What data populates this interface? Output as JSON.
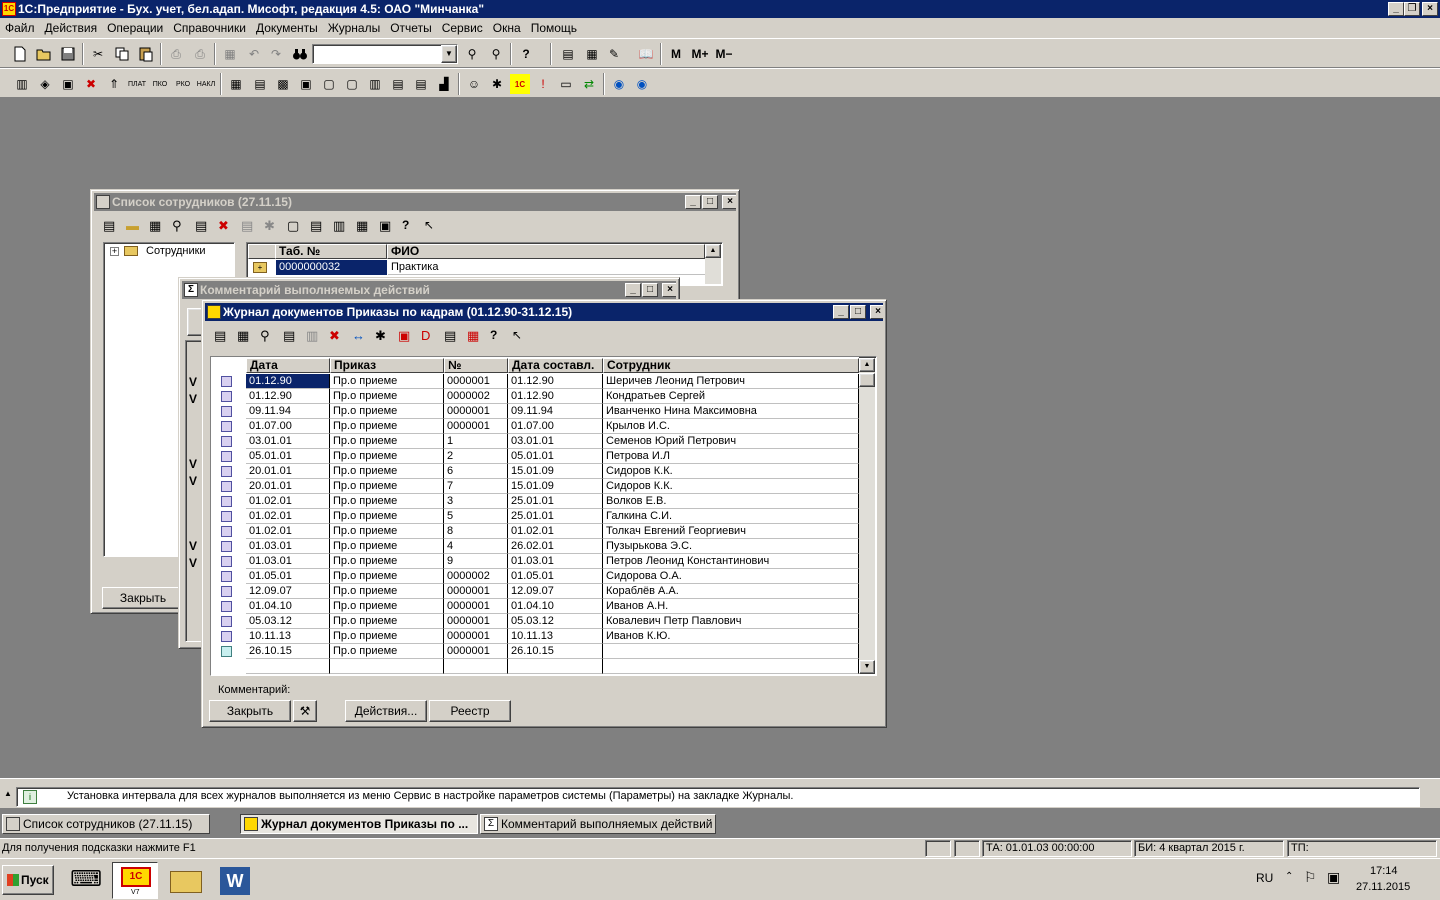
{
  "app": {
    "title": "1С:Предприятие - Бух. учет, бел.адап. Мисофт, редакция 4.5: ОАО \"Минчанка\""
  },
  "menu": [
    "Файл",
    "Действия",
    "Операции",
    "Справочники",
    "Документы",
    "Журналы",
    "Отчеты",
    "Сервис",
    "Окна",
    "Помощь"
  ],
  "toolbar": {
    "m1": "M",
    "m2": "M+",
    "m3": "M−"
  },
  "employees_window": {
    "title": "Список сотрудников (27.11.15)",
    "tree_root": "Сотрудники",
    "columns": [
      "Таб. №",
      "ФИО"
    ],
    "rows": [
      [
        "0000000032",
        "Практика"
      ]
    ],
    "close_button": "Закрыть"
  },
  "comment_window": {
    "title": "Комментарий выполняемых действий",
    "marks": [
      "V",
      "V",
      "V",
      "V",
      "V",
      "V"
    ]
  },
  "journal_window": {
    "title": "Журнал документов  Приказы по кадрам (01.12.90-31.12.15)",
    "columns": [
      "Дата",
      "Приказ",
      "№",
      "Дата составл.",
      "Сотрудник"
    ],
    "rows": [
      [
        "01.12.90",
        "Пр.о приеме",
        "0000001",
        "01.12.90",
        "Шеричев Леонид Петрович"
      ],
      [
        "01.12.90",
        "Пр.о приеме",
        "0000002",
        "01.12.90",
        "Кондратьев Сергей"
      ],
      [
        "09.11.94",
        "Пр.о приеме",
        "0000001",
        "09.11.94",
        "Иванченко Нина Максимовна"
      ],
      [
        "01.07.00",
        "Пр.о приеме",
        "0000001",
        "01.07.00",
        "Крылов И.С."
      ],
      [
        "03.01.01",
        "Пр.о приеме",
        "1",
        "03.01.01",
        "Семенов Юрий Петрович"
      ],
      [
        "05.01.01",
        "Пр.о приеме",
        "2",
        "05.01.01",
        "Петрова И.Л"
      ],
      [
        "20.01.01",
        "Пр.о приеме",
        "6",
        "15.01.09",
        "Сидоров К.К."
      ],
      [
        "20.01.01",
        "Пр.о приеме",
        "7",
        "15.01.09",
        "Сидоров К.К."
      ],
      [
        "01.02.01",
        "Пр.о приеме",
        "3",
        "25.01.01",
        "Волков Е.В."
      ],
      [
        "01.02.01",
        "Пр.о приеме",
        "5",
        "25.01.01",
        "Галкина С.И."
      ],
      [
        "01.02.01",
        "Пр.о приеме",
        "8",
        "01.02.01",
        "Толкач Евгений Георгиевич"
      ],
      [
        "01.03.01",
        "Пр.о приеме",
        "4",
        "26.02.01",
        "Пузырькова Э.С."
      ],
      [
        "01.03.01",
        "Пр.о приеме",
        "9",
        "01.03.01",
        "Петров Леонид Константинович"
      ],
      [
        "01.05.01",
        "Пр.о приеме",
        "0000002",
        "01.05.01",
        "Сидорова О.А."
      ],
      [
        "12.09.07",
        "Пр.о приеме",
        "0000001",
        "12.09.07",
        "Кораблёв А.А."
      ],
      [
        "01.04.10",
        "Пр.о приеме",
        "0000001",
        "01.04.10",
        "Иванов А.Н."
      ],
      [
        "05.03.12",
        "Пр.о приеме",
        "0000001",
        "05.03.12",
        "Ковалевич Петр Павлович"
      ],
      [
        "10.11.13",
        "Пр.о приеме",
        "0000001",
        "10.11.13",
        "Иванов К.Ю."
      ],
      [
        "26.10.15",
        "Пр.о приеме",
        "0000001",
        "26.10.15",
        ""
      ]
    ],
    "comment_label": "Комментарий:",
    "buttons": {
      "close": "Закрыть",
      "actions": "Действия...",
      "registry": "Реестр"
    }
  },
  "message_bar": "Установка интервала для всех журналов выполняется из меню Сервис в настройке параметров системы (Параметры) на закладке Журналы.",
  "taskbar_windows": [
    "Список сотрудников (27.11.15)",
    "Журнал документов  Приказы по ...",
    "Комментарий выполняемых действий"
  ],
  "status": {
    "hint": "Для получения подсказки нажмите F1",
    "ta": "ТА: 01.01.03  00:00:00",
    "bi": "БИ: 4 квартал 2015 г.",
    "tp": "ТП:"
  },
  "os_taskbar": {
    "start": "Пуск",
    "lang": "RU",
    "time": "17:14",
    "date": "27.11.2015",
    "app_label": "V7"
  }
}
